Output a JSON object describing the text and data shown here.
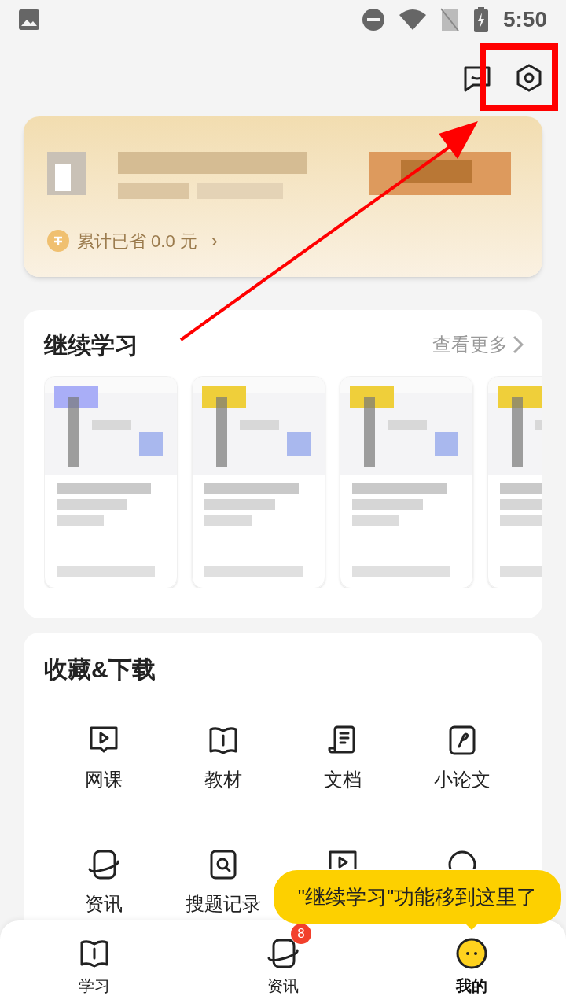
{
  "status_bar": {
    "time": "5:50"
  },
  "banner": {
    "savings": "累计已省 0.0 元",
    "chevron": "›"
  },
  "continue_learning": {
    "title": "继续学习",
    "more": "查看更多"
  },
  "favorites": {
    "title": "收藏&下载",
    "items": [
      {
        "kind": "labeled",
        "label": "网课"
      },
      {
        "kind": "labeled",
        "label": "教材"
      },
      {
        "kind": "labeled",
        "label": "文档"
      },
      {
        "kind": "labeled",
        "label": "小论文"
      },
      {
        "kind": "labeled",
        "label": "资讯"
      },
      {
        "kind": "labeled",
        "label": "搜题记录"
      },
      {
        "kind": "covered"
      },
      {
        "kind": "covered"
      }
    ]
  },
  "tooltip": "\"继续学习\"功能移到这里了",
  "bottom_nav": [
    {
      "label": "学习",
      "selected": false
    },
    {
      "label": "资讯",
      "selected": false,
      "badge": "8"
    },
    {
      "label": "我的",
      "selected": true
    }
  ]
}
